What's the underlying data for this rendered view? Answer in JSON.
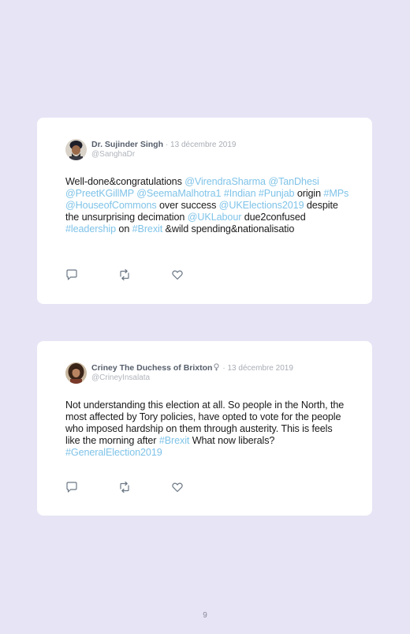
{
  "tweets": [
    {
      "display_name": "Dr. Sujinder Singh",
      "date": "· 13 décembre 2019",
      "handle": "@SanghaDr",
      "avatar_icon": "person-with-turban-avatar",
      "body": [
        {
          "text": "Well-done&congratulations ",
          "link": false
        },
        {
          "text": "@VirendraSharma",
          "link": true
        },
        {
          "text": " ",
          "link": false
        },
        {
          "text": "@TanDhesi",
          "link": true
        },
        {
          "text": " ",
          "link": false
        },
        {
          "text": "@PreetKGillMP",
          "link": true
        },
        {
          "text": " ",
          "link": false
        },
        {
          "text": "@SeemaMalhotra1",
          "link": true
        },
        {
          "text": " ",
          "link": false
        },
        {
          "text": "#Indian",
          "link": true
        },
        {
          "text": " ",
          "link": false
        },
        {
          "text": "#Punjab",
          "link": true
        },
        {
          "text": " origin ",
          "link": false
        },
        {
          "text": "#MPs",
          "link": true
        },
        {
          "text": " ",
          "link": false
        },
        {
          "text": "@HouseofCommons",
          "link": true
        },
        {
          "text": " over success ",
          "link": false
        },
        {
          "text": "@UKElections2019",
          "link": true
        },
        {
          "text": " despite the unsurprising decimation ",
          "link": false
        },
        {
          "text": "@UKLabour",
          "link": true
        },
        {
          "text": " due2confused ",
          "link": false
        },
        {
          "text": "#leadership",
          "link": true
        },
        {
          "text": " on ",
          "link": false
        },
        {
          "text": "#Brexit",
          "link": true
        },
        {
          "text": " &wild spending&nationalisatio",
          "link": false
        }
      ],
      "actions": [
        "reply-icon",
        "retweet-icon",
        "like-icon"
      ]
    },
    {
      "display_name": "Criney The Duchess of Brixton",
      "date": "· 13 décembre 2019",
      "handle": "@CrineyInsalata",
      "avatar_icon": "woman-avatar",
      "badge_icon": "female-symbol-icon",
      "body": [
        {
          "text": "Not understanding this election at all. So people in the North, the most affected by Tory policies, have opted to vote for the people who imposed hardship on them through austerity. This is feels like the morning after ",
          "link": false
        },
        {
          "text": "#Brexit",
          "link": true
        },
        {
          "text": " What now liberals? ",
          "link": false
        },
        {
          "text": "#GeneralElection2019",
          "link": true
        }
      ],
      "actions": [
        "reply-icon",
        "retweet-icon",
        "like-icon"
      ]
    }
  ],
  "page_number": "9",
  "colors": {
    "background": "#e6e4f5",
    "card": "#ffffff",
    "link": "#7fc3e8",
    "name": "#555e6b",
    "muted": "#a9adb5"
  }
}
